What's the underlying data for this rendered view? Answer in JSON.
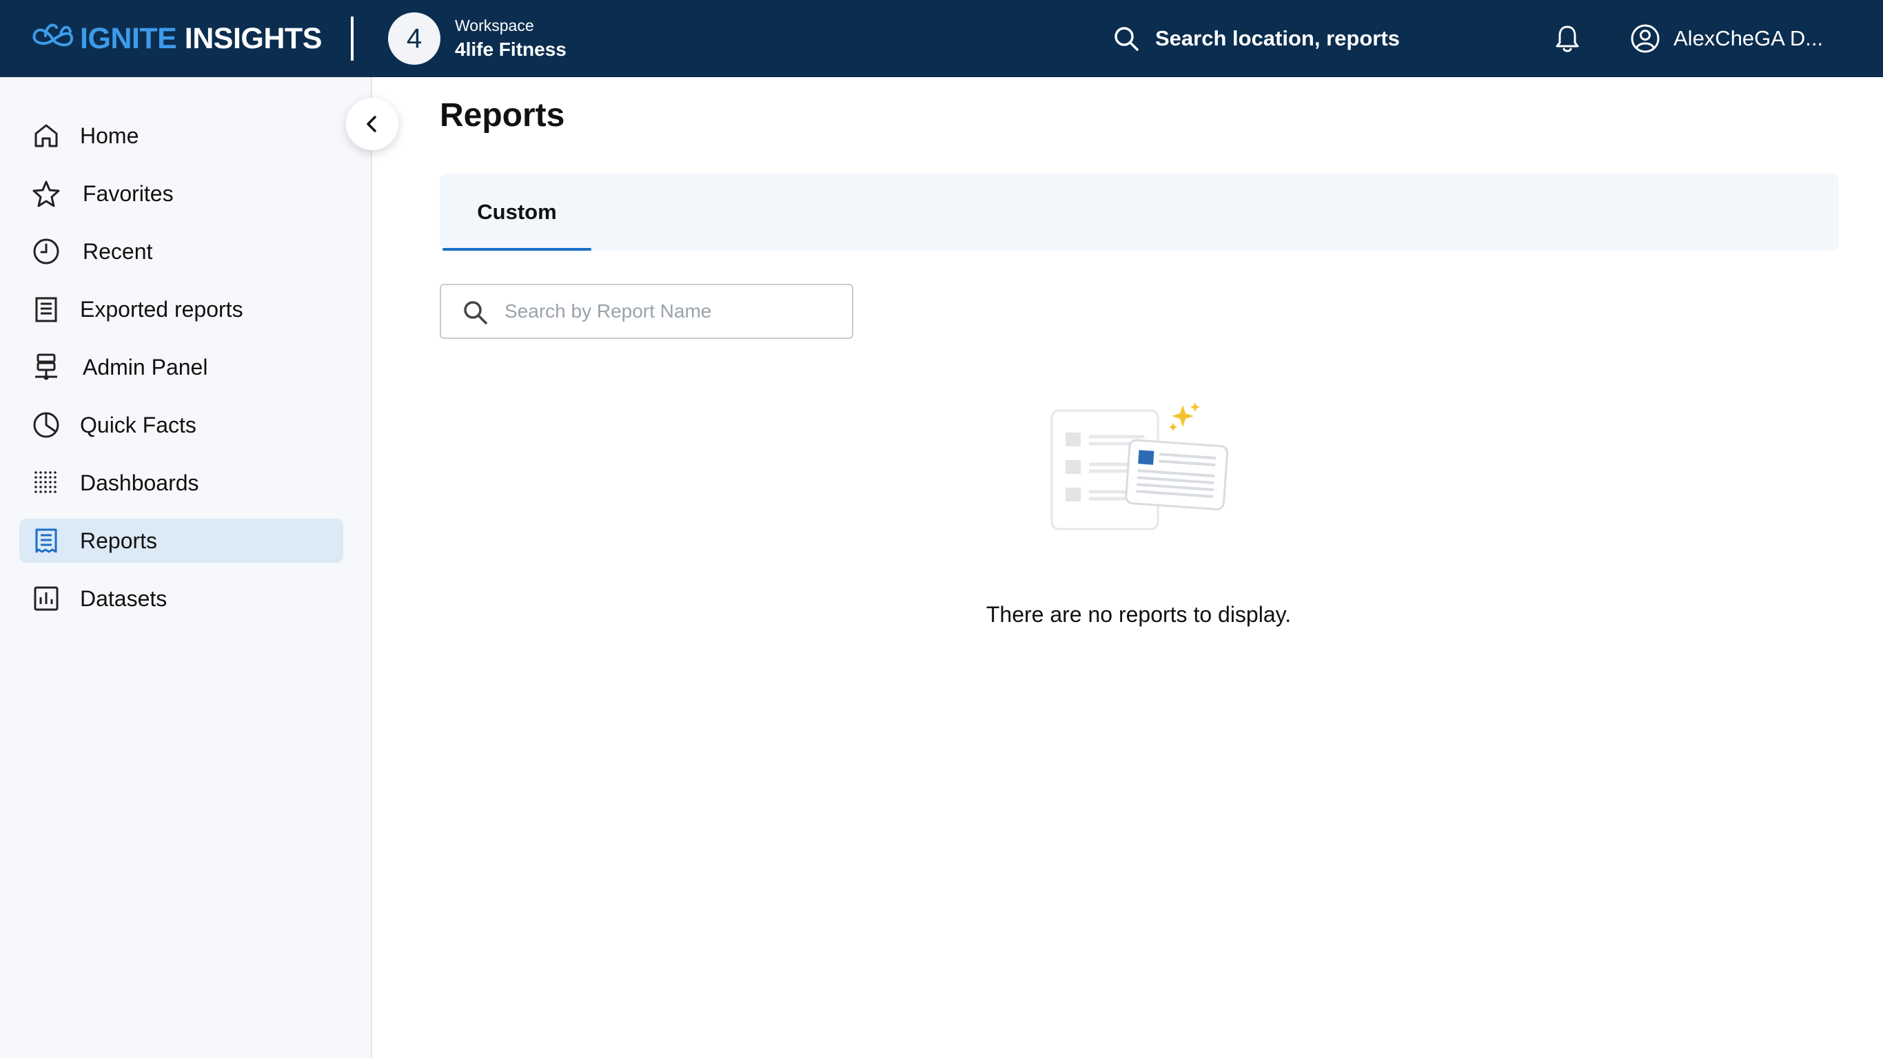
{
  "header": {
    "brand_part1": "IGNITE",
    "brand_part2": "INSIGHTS",
    "workspace_badge": "4",
    "workspace_label": "Workspace",
    "workspace_name": "4life Fitness",
    "search_text": "Search location, reports",
    "user_name": "AlexCheGA D...",
    "icons": {
      "logo": "infinity-logo",
      "search": "search-icon",
      "bell": "bell-icon",
      "user": "user-circle-icon"
    }
  },
  "sidebar": {
    "items": [
      {
        "label": "Home",
        "icon": "home-icon",
        "active": false
      },
      {
        "label": "Favorites",
        "icon": "star-icon",
        "active": false
      },
      {
        "label": "Recent",
        "icon": "clock-icon",
        "active": false
      },
      {
        "label": "Exported reports",
        "icon": "exported-reports-icon",
        "active": false
      },
      {
        "label": "Admin Panel",
        "icon": "admin-panel-icon",
        "active": false
      },
      {
        "label": "Quick Facts",
        "icon": "pie-chart-icon",
        "active": false
      },
      {
        "label": "Dashboards",
        "icon": "dots-grid-icon",
        "active": false
      },
      {
        "label": "Reports",
        "icon": "reports-icon",
        "active": true
      },
      {
        "label": "Datasets",
        "icon": "bar-chart-icon",
        "active": false
      }
    ],
    "collapse_icon": "chevron-left-icon"
  },
  "main": {
    "title": "Reports",
    "tabs": [
      {
        "label": "Custom",
        "selected": true
      }
    ],
    "search": {
      "placeholder": "Search by Report Name",
      "value": ""
    },
    "empty_message": "There are no reports to display."
  },
  "colors": {
    "header_bg": "#0b2d4f",
    "brand_accent": "#3d9be9",
    "active_nav_bg": "#dce9f6",
    "tab_underline": "#1b6fc9",
    "sidebar_bg": "#f6f8fb"
  }
}
